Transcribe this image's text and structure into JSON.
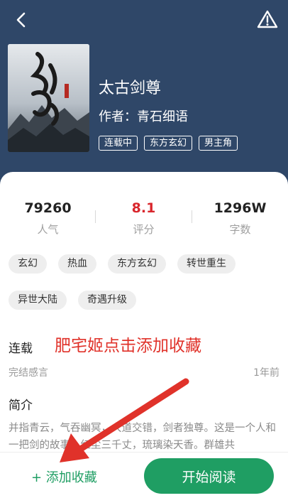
{
  "header": {
    "back_icon": "chevron-left-icon",
    "report_icon": "warning-triangle-icon",
    "background_color": "#2f4768"
  },
  "book": {
    "title": "太古剑尊",
    "author_text": "作者：青石细语",
    "status_tags": [
      "连载中",
      "东方玄幻",
      "男主角"
    ]
  },
  "stats": [
    {
      "value": "79260",
      "label": "人气"
    },
    {
      "value": "8.1",
      "label": "评分"
    },
    {
      "value": "1296W",
      "label": "字数"
    }
  ],
  "genre_tags": [
    "玄幻",
    "热血",
    "东方玄幻",
    "转世重生",
    "异世大陆",
    "奇遇升级"
  ],
  "serial": {
    "heading": "连载",
    "annotation": "肥宅姬点击添加收藏",
    "end_note_label": "完结感言",
    "end_note_time": "1年前"
  },
  "intro": {
    "heading": "简介",
    "text": "并指青云，气吞幽冥，大道交错，剑者独尊。这是一个人和一把剑的故事，红尘三千丈，琉璃染天香。群雄共"
  },
  "bottom_bar": {
    "add_favorite": "+ 添加收藏",
    "start_reading": "开始阅读",
    "accent_color": "#1f9e63"
  },
  "colors": {
    "rating_red": "#d9262c",
    "annotation_red": "#e0322a"
  }
}
